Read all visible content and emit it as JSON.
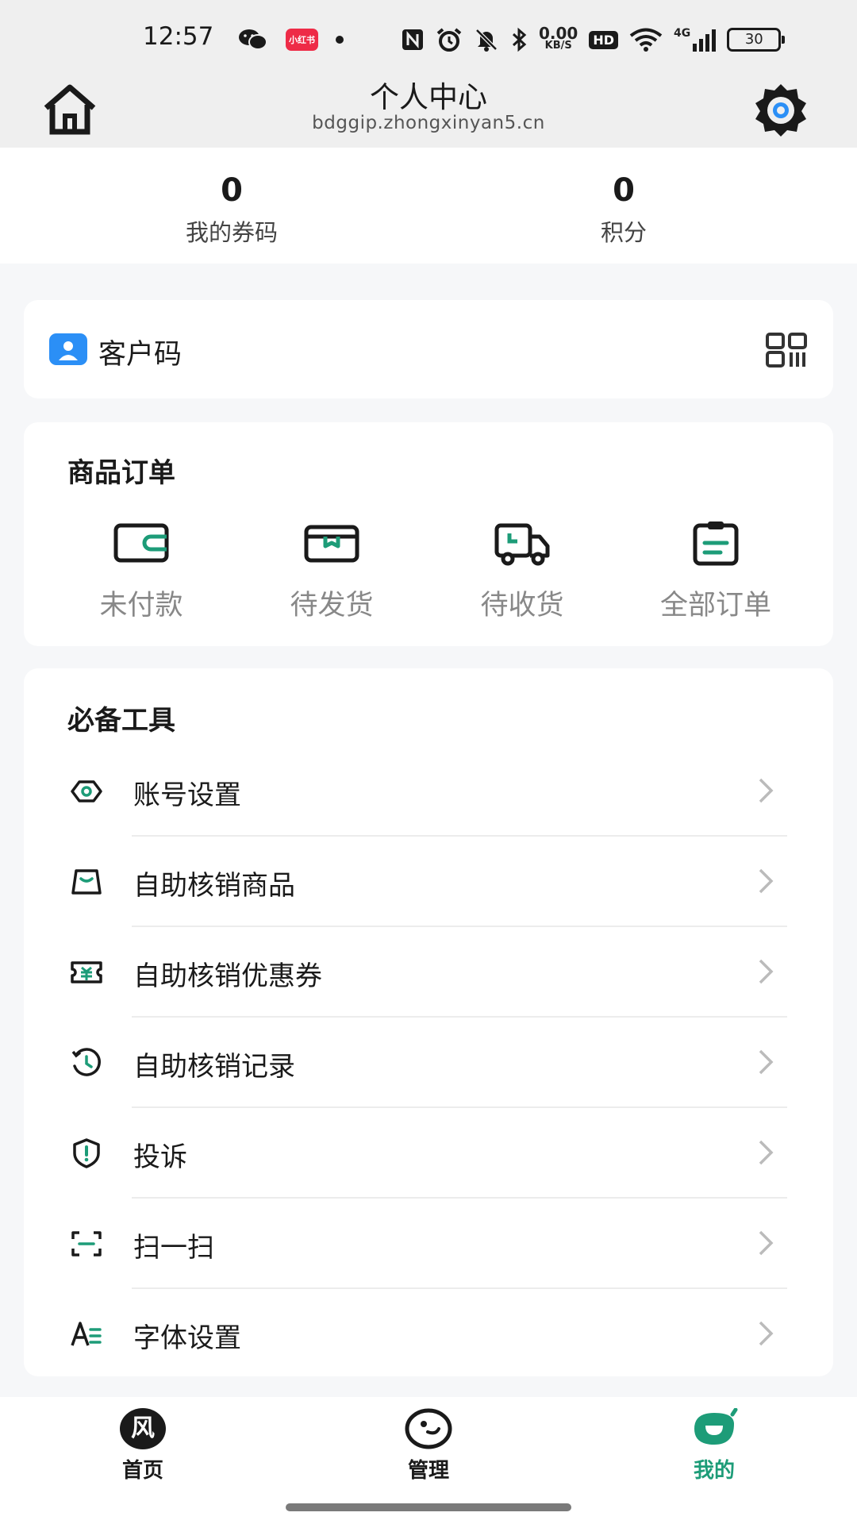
{
  "status_bar": {
    "time": "12:57",
    "red_app_text": "小红书",
    "net_speed_value": "0.00",
    "net_speed_unit": "KB/S",
    "hd": "HD",
    "network": "4G",
    "battery": "30"
  },
  "header": {
    "title": "个人中心",
    "subtitle": "bdggip.zhongxinyan5.cn"
  },
  "stats": [
    {
      "value": "0",
      "label": "我的券码"
    },
    {
      "value": "0",
      "label": "积分"
    }
  ],
  "customer_code": {
    "label": "客户码"
  },
  "orders": {
    "title": "商品订单",
    "items": [
      {
        "label": "未付款",
        "icon": "wallet-icon"
      },
      {
        "label": "待发货",
        "icon": "package-icon"
      },
      {
        "label": "待收货",
        "icon": "truck-icon"
      },
      {
        "label": "全部订单",
        "icon": "clipboard-icon"
      }
    ]
  },
  "tools": {
    "title": "必备工具",
    "items": [
      {
        "label": "账号设置",
        "icon": "eye-hexagon-icon"
      },
      {
        "label": "自助核销商品",
        "icon": "bag-icon"
      },
      {
        "label": "自助核销优惠券",
        "icon": "ticket-icon"
      },
      {
        "label": "自助核销记录",
        "icon": "history-icon"
      },
      {
        "label": "投诉",
        "icon": "shield-alert-icon"
      },
      {
        "label": "扫一扫",
        "icon": "scan-icon"
      },
      {
        "label": "字体设置",
        "icon": "font-icon"
      }
    ]
  },
  "tabbar": {
    "items": [
      {
        "label": "首页",
        "icon_text": "风",
        "icon": "home-badge-icon",
        "active": false
      },
      {
        "label": "管理",
        "icon": "manage-icon",
        "active": false
      },
      {
        "label": "我的",
        "icon": "profile-icon",
        "active": true
      }
    ]
  },
  "colors": {
    "accent": "#1d9c78",
    "customer_icon": "#2b8ff6",
    "text": "#1a1a1a",
    "muted": "#888888"
  }
}
